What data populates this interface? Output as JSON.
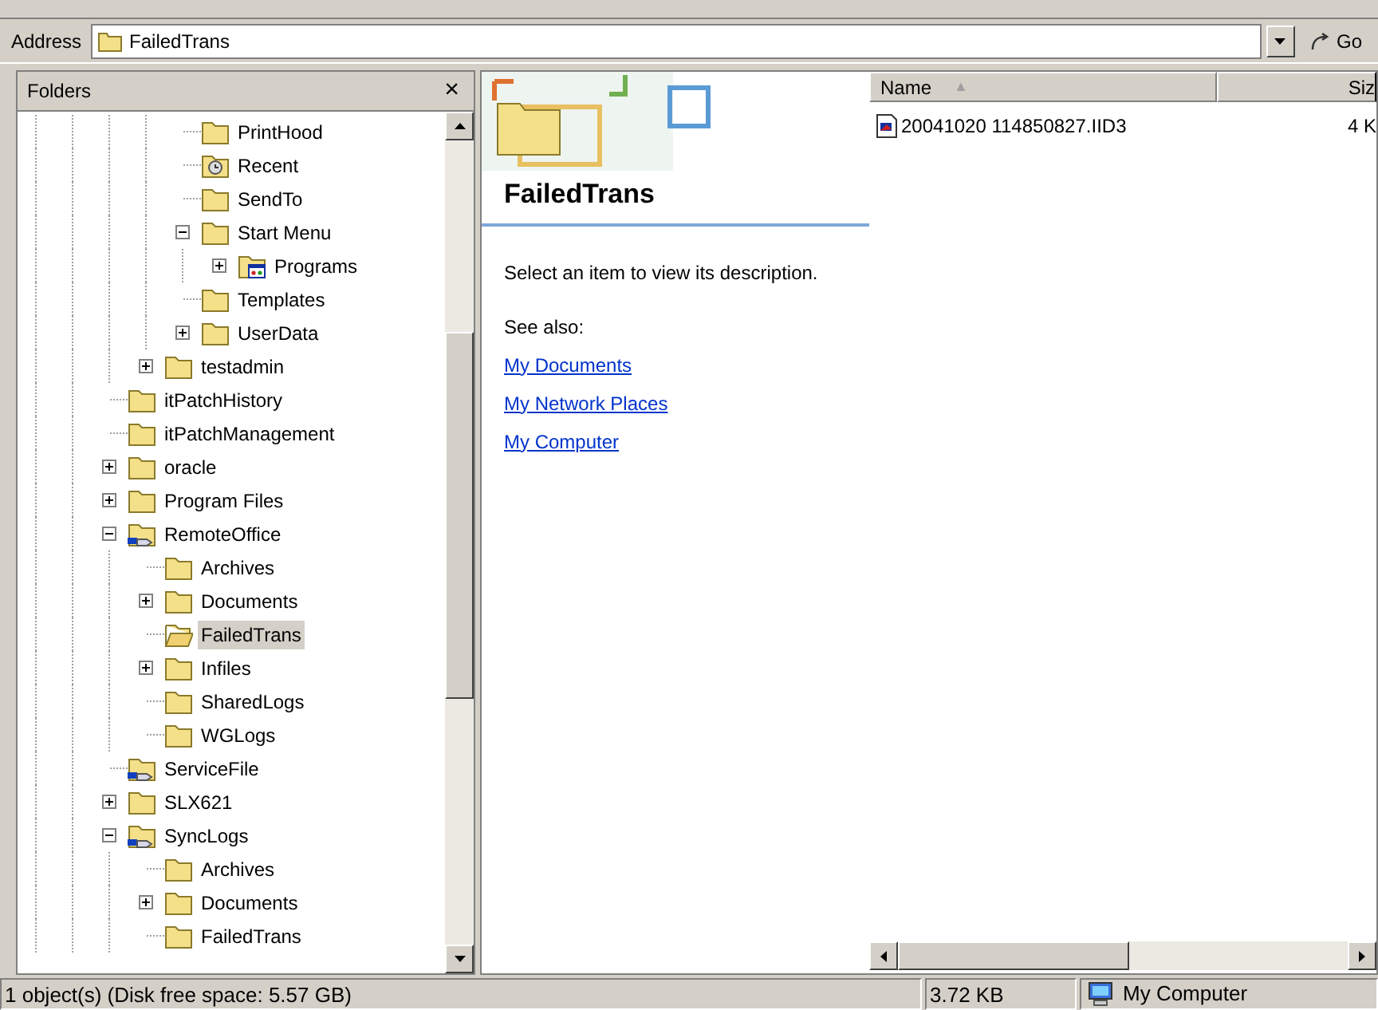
{
  "address_bar": {
    "label": "Address",
    "value": "FailedTrans",
    "go": "Go"
  },
  "folders_pane": {
    "title": "Folders",
    "close": "×",
    "tree": [
      {
        "children": [
          {
            "children": [
              {
                "children": [
                  {
                    "children": [
                      {
                        "label": "PrintHood",
                        "kind": "folder",
                        "selected": false
                      },
                      {
                        "label": "Recent",
                        "kind": "recent",
                        "selected": false
                      },
                      {
                        "label": "SendTo",
                        "kind": "folder",
                        "selected": false
                      },
                      {
                        "label": "Start Menu",
                        "kind": "folder",
                        "selected": false,
                        "expanded": true,
                        "children": [
                          {
                            "label": "Programs",
                            "kind": "programs",
                            "selected": false,
                            "expanded": false
                          }
                        ]
                      },
                      {
                        "label": "Templates",
                        "kind": "folder",
                        "selected": false
                      },
                      {
                        "label": "UserData",
                        "kind": "folder",
                        "selected": false,
                        "expanded": false
                      }
                    ]
                  },
                  {
                    "label": "testadmin",
                    "kind": "folder",
                    "selected": false,
                    "expanded": false
                  }
                ]
              },
              {
                "label": "itPatchHistory",
                "kind": "folder",
                "selected": false
              },
              {
                "label": "itPatchManagement",
                "kind": "folder",
                "selected": false
              },
              {
                "label": "oracle",
                "kind": "folder",
                "selected": false,
                "expanded": false
              },
              {
                "label": "Program Files",
                "kind": "folder",
                "selected": false,
                "expanded": false
              },
              {
                "label": "RemoteOffice",
                "kind": "shared",
                "selected": false,
                "expanded": true,
                "children": [
                  {
                    "label": "Archives",
                    "kind": "folder",
                    "selected": false
                  },
                  {
                    "label": "Documents",
                    "kind": "folder",
                    "selected": false,
                    "expanded": false
                  },
                  {
                    "label": "FailedTrans",
                    "kind": "open",
                    "selected": true
                  },
                  {
                    "label": "Infiles",
                    "kind": "folder",
                    "selected": false,
                    "expanded": false
                  },
                  {
                    "label": "SharedLogs",
                    "kind": "folder",
                    "selected": false
                  },
                  {
                    "label": "WGLogs",
                    "kind": "folder",
                    "selected": false
                  }
                ]
              },
              {
                "label": "ServiceFile",
                "kind": "shared",
                "selected": false
              },
              {
                "label": "SLX621",
                "kind": "folder",
                "selected": false,
                "expanded": false
              },
              {
                "label": "SyncLogs",
                "kind": "shared",
                "selected": false,
                "expanded": true,
                "children": [
                  {
                    "label": "Archives",
                    "kind": "folder",
                    "selected": false
                  },
                  {
                    "label": "Documents",
                    "kind": "folder",
                    "selected": false,
                    "expanded": false
                  },
                  {
                    "label": "FailedTrans",
                    "kind": "folder",
                    "selected": false
                  }
                ]
              }
            ]
          }
        ]
      }
    ]
  },
  "task_pane": {
    "title": "FailedTrans",
    "description": "Select an item to view its description.",
    "see_also": "See also:",
    "links": [
      "My Documents",
      "My Network Places",
      "My Computer"
    ]
  },
  "file_list": {
    "columns": [
      "Name",
      "Siz"
    ],
    "sort_indicator": "▲",
    "rows": [
      {
        "name": "20041020 114850827.IID3",
        "size": "4 K"
      }
    ]
  },
  "status_bar": {
    "objects": "1 object(s) (Disk free space: 5.57 GB)",
    "size": "3.72 KB",
    "zone": "My Computer"
  }
}
